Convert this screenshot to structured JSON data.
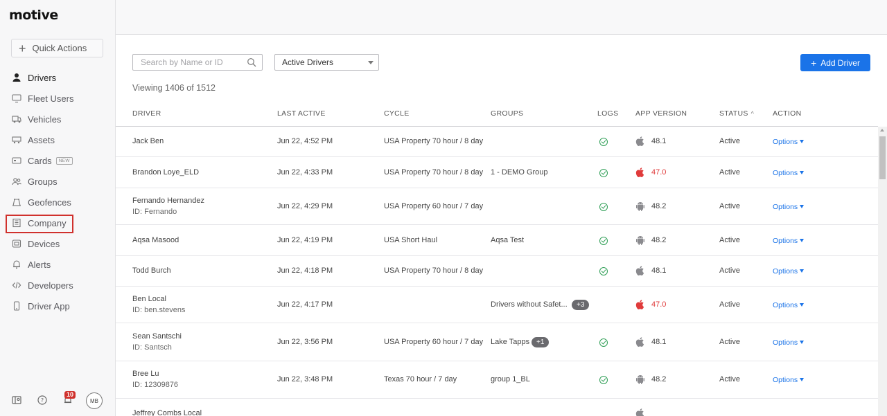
{
  "sidebar": {
    "logo": "motive",
    "quick_actions_label": "Quick Actions",
    "items": [
      {
        "label": "Drivers",
        "icon": "person-icon"
      },
      {
        "label": "Fleet Users",
        "icon": "monitor-icon"
      },
      {
        "label": "Vehicles",
        "icon": "truck-icon"
      },
      {
        "label": "Assets",
        "icon": "trailer-icon"
      },
      {
        "label": "Cards",
        "icon": "card-icon",
        "badge": "NEW"
      },
      {
        "label": "Groups",
        "icon": "group-icon"
      },
      {
        "label": "Geofences",
        "icon": "geofence-icon"
      },
      {
        "label": "Company",
        "icon": "building-icon"
      },
      {
        "label": "Devices",
        "icon": "devices-icon"
      },
      {
        "label": "Alerts",
        "icon": "bell-icon"
      },
      {
        "label": "Developers",
        "icon": "code-icon"
      },
      {
        "label": "Driver App",
        "icon": "phone-icon"
      }
    ],
    "footer": {
      "notification_count": "10",
      "avatar_initials": "MB"
    }
  },
  "toolbar": {
    "search_placeholder": "Search by Name or ID",
    "filter_value": "Active Drivers",
    "add_driver_label": "Add Driver",
    "viewing_text": "Viewing 1406 of 1512"
  },
  "table": {
    "columns": [
      "DRIVER",
      "LAST ACTIVE",
      "CYCLE",
      "GROUPS",
      "LOGS",
      "APP VERSION",
      "STATUS",
      "ACTION"
    ],
    "rows": [
      {
        "name": "Jack Ben",
        "id": "",
        "last_active": "Jun 22, 4:52 PM",
        "cycle": "USA Property 70 hour / 8 day",
        "group": "",
        "extra": "",
        "logs": true,
        "platform": "apple",
        "version": "48.1",
        "outdated": false,
        "status": "Active",
        "action": "Options"
      },
      {
        "name": "Brandon Loye_ELD",
        "id": "",
        "last_active": "Jun 22, 4:33 PM",
        "cycle": "USA Property 70 hour / 8 day",
        "group": "1 - DEMO Group",
        "extra": "",
        "logs": true,
        "platform": "apple",
        "version": "47.0",
        "outdated": true,
        "status": "Active",
        "action": "Options"
      },
      {
        "name": "Fernando Hernandez",
        "id": "ID: Fernando",
        "last_active": "Jun 22, 4:29 PM",
        "cycle": "USA Property 60 hour / 7 day",
        "group": "",
        "extra": "",
        "logs": true,
        "platform": "android",
        "version": "48.2",
        "outdated": false,
        "status": "Active",
        "action": "Options"
      },
      {
        "name": "Aqsa Masood",
        "id": "",
        "last_active": "Jun 22, 4:19 PM",
        "cycle": "USA Short Haul",
        "group": "Aqsa Test",
        "extra": "",
        "logs": true,
        "platform": "android",
        "version": "48.2",
        "outdated": false,
        "status": "Active",
        "action": "Options"
      },
      {
        "name": "Todd Burch",
        "id": "",
        "last_active": "Jun 22, 4:18 PM",
        "cycle": "USA Property 70 hour / 8 day",
        "group": "",
        "extra": "",
        "logs": true,
        "platform": "apple",
        "version": "48.1",
        "outdated": false,
        "status": "Active",
        "action": "Options"
      },
      {
        "name": "Ben Local",
        "id": "ID: ben.stevens",
        "last_active": "Jun 22, 4:17 PM",
        "cycle": "",
        "group": "Drivers without Safet...",
        "extra": "+3",
        "logs": false,
        "platform": "apple",
        "version": "47.0",
        "outdated": true,
        "status": "Active",
        "action": "Options"
      },
      {
        "name": "Sean Santschi",
        "id": "ID: Santsch",
        "last_active": "Jun 22, 3:56 PM",
        "cycle": "USA Property 60 hour / 7 day",
        "group": "Lake Tapps",
        "extra": "+1",
        "logs": true,
        "platform": "apple",
        "version": "48.1",
        "outdated": false,
        "status": "Active",
        "action": "Options"
      },
      {
        "name": "Bree Lu",
        "id": "ID: 12309876",
        "last_active": "Jun 22, 3:48 PM",
        "cycle": "Texas 70 hour / 7 day",
        "group": "group 1_BL",
        "extra": "",
        "logs": true,
        "platform": "android",
        "version": "48.2",
        "outdated": false,
        "status": "Active",
        "action": "Options"
      },
      {
        "name": "Jeffrey Combs Local",
        "id": "",
        "last_active": "",
        "cycle": "",
        "group": "",
        "extra": "",
        "logs": false,
        "platform": "apple",
        "version": "",
        "outdated": false,
        "status": "",
        "action": ""
      }
    ]
  },
  "colors": {
    "accent": "#1a73e8",
    "ok": "#2e9e55",
    "outdated": "#e03b3b",
    "highlight": "#d0312d"
  }
}
